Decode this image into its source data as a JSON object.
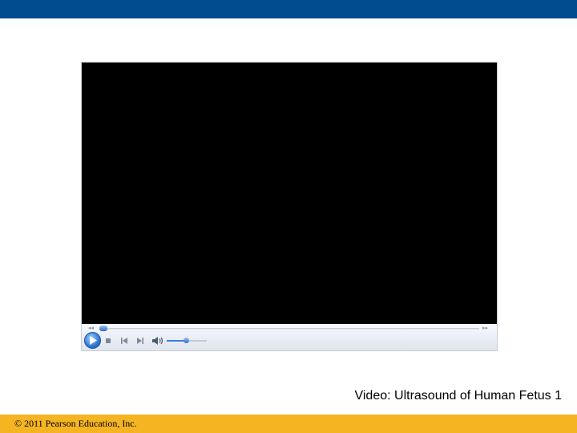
{
  "slide": {
    "caption": "Video: Ultrasound of Human Fetus 1",
    "footer": "© 2011 Pearson Education, Inc.",
    "colors": {
      "header_bar": "#004b8d",
      "footer_bar": "#f5b422",
      "video_background": "#000000"
    }
  },
  "player": {
    "seek_progress": 0,
    "volume_level": 0.54,
    "icons": [
      "rewind-marker-icon",
      "play-icon",
      "stop-icon",
      "previous-icon",
      "next-icon",
      "volume-icon",
      "fast-forward-marker-icon"
    ]
  }
}
